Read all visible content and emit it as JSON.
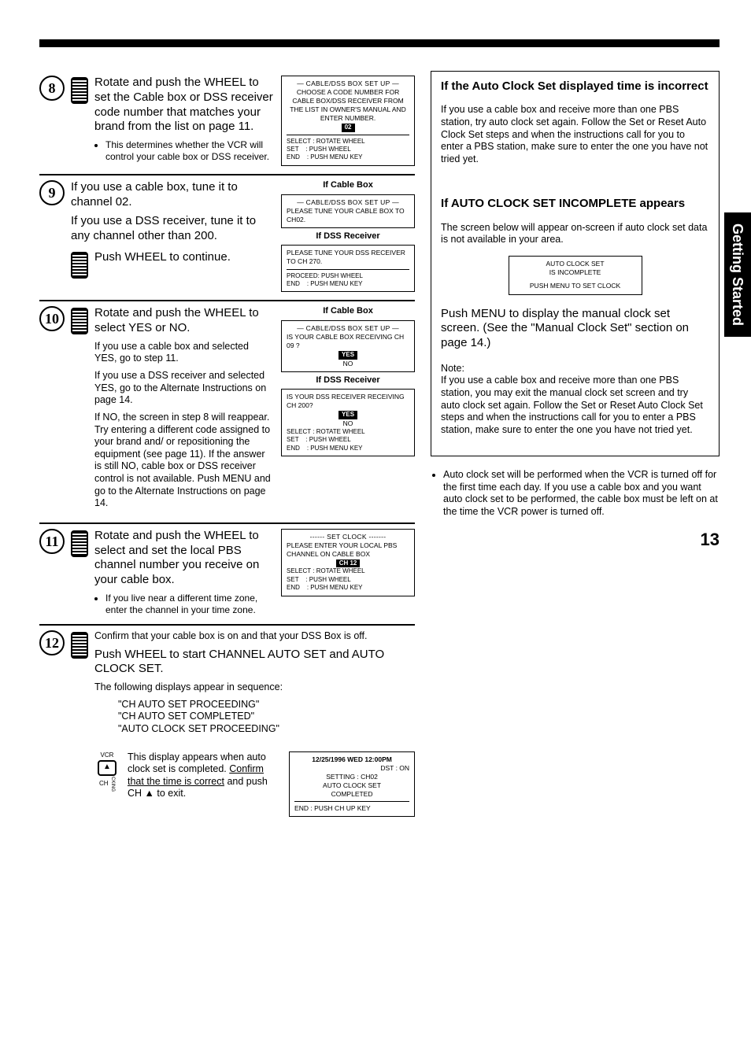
{
  "tab": "Getting Started",
  "page_number": "13",
  "steps": {
    "s8": {
      "num": "8",
      "main": "Rotate and push the WHEEL to set the Cable box or DSS receiver code number that matches your brand from the list on page 11.",
      "bullet": "This determines whether the VCR will control your cable box or DSS receiver.",
      "osd": {
        "title": "— CABLE/DSS BOX SET UP —",
        "body": "CHOOSE A CODE NUMBER FOR CABLE BOX/DSS RECEIVER FROM THE LIST IN OWNER'S MANUAL AND ENTER NUMBER.",
        "chip": "02",
        "legend": "SELECT : ROTATE WHEEL\nSET    : PUSH WHEEL\nEND    : PUSH MENU KEY"
      }
    },
    "s9": {
      "num": "9",
      "p1": "If you use a cable box, tune it to channel 02.",
      "p2": "If you use a DSS receiver, tune it to any channel other than 200.",
      "p3": "Push WHEEL to continue.",
      "osd_a_label": "If Cable Box",
      "osd_a": {
        "title": "— CABLE/DSS BOX SET UP —",
        "body": "PLEASE TUNE YOUR CABLE BOX TO CH02."
      },
      "osd_b_label": "If DSS Receiver",
      "osd_b": {
        "body": "PLEASE TUNE YOUR DSS RECEIVER TO CH 270.",
        "legend": "PROCEED: PUSH WHEEL\nEND    : PUSH MENU KEY"
      }
    },
    "s10": {
      "num": "10",
      "main": "Rotate and push the WHEEL to select YES or NO.",
      "p1": "If you use a cable box and selected YES, go to step 11.",
      "p2": "If you use a DSS receiver and selected YES, go to the Alternate Instructions on page 14.",
      "p3": "If NO, the screen in step 8 will reappear. Try entering a different code assigned to your brand and/ or repositioning the equipment (see page 11). If the answer is still NO, cable box or DSS receiver control is not available. Push MENU and go to the Alternate Instructions on page 14.",
      "osd_a_label": "If Cable Box",
      "osd_a": {
        "title": "— CABLE/DSS BOX SET UP —",
        "body": "IS YOUR CABLE BOX RECEIVING CH 09 ?",
        "chip": "YES",
        "opt": "NO"
      },
      "osd_b_label": "If DSS Receiver",
      "osd_b": {
        "body": "IS YOUR DSS RECEIVER RECEIVING CH 200?",
        "chip": "YES",
        "opt": "NO",
        "legend": "SELECT : ROTATE WHEEL\nSET    : PUSH WHEEL\nEND    : PUSH MENU KEY"
      }
    },
    "s11": {
      "num": "11",
      "main": "Rotate and push the WHEEL to select and set the local PBS channel number you receive on your cable box.",
      "bullet": "If you live near a different time zone, enter the channel in your time zone.",
      "osd": {
        "title": "------ SET CLOCK -------",
        "body": "PLEASE ENTER YOUR LOCAL PBS CHANNEL ON CABLE BOX",
        "chip": "CH 12",
        "legend": "SELECT : ROTATE WHEEL\nSET    : PUSH WHEEL\nEND    : PUSH MENU KEY"
      }
    },
    "s12": {
      "num": "12",
      "p1": "Confirm that your cable box is on and that your DSS Box is off.",
      "p2": "Push WHEEL to start CHANNEL AUTO SET and AUTO CLOCK SET.",
      "p3": "The following displays appear in sequence:",
      "seq1": "\"CH AUTO SET PROCEEDING\"",
      "seq2": "\"CH AUTO SET COMPLETED\"",
      "seq3": "\"AUTO CLOCK SET PROCEEDING\"",
      "conf_pre": "This display appears when auto clock set is completed. ",
      "conf_u": "Confirm that the time is correct",
      "conf_post": " and push CH ▲ to exit.",
      "vcr_top": "VCR",
      "vcr_bot": "CH",
      "vcr_side": "CKING",
      "osd": {
        "l1": "12/25/1996 WED 12:00PM",
        "l2": "DST : ON",
        "l3": "SETTING : CH02",
        "l4": "AUTO CLOCK SET",
        "l5": "COMPLETED",
        "l6": "END : PUSH CH UP KEY"
      }
    }
  },
  "side": {
    "box1": {
      "h": "If the Auto Clock Set displayed time is incorrect",
      "p": "If you use a cable box and receive more than one PBS station, try auto clock set again. Follow the Set or Reset Auto Clock Set steps and when the instructions call for you to enter a PBS station, make sure to enter the one you have not tried yet."
    },
    "box2": {
      "h": "If AUTO CLOCK SET INCOMPLETE appears",
      "p1": "The screen below will appear on-screen if auto clock set data is not available in your area.",
      "osd_l1": "AUTO CLOCK SET",
      "osd_l2": "IS INCOMPLETE",
      "osd_l3": "PUSH MENU TO SET CLOCK",
      "p2": "Push MENU to display the manual clock set screen. (See the \"Manual Clock Set\" section on page 14.)",
      "p3h": "Note:",
      "p3": "If you use a cable box and receive more than one PBS station, you may exit the manual clock set screen and try auto clock set again. Follow the Set or Reset Auto Clock Set steps and when the instructions call for you to enter a PBS station, make sure to enter the one you have not tried yet."
    },
    "bullet": "Auto clock set will be performed when the VCR is turned off for the first time each day. If you use a cable box and you want auto clock set to be performed, the cable box must be left on at the time the VCR power is turned off."
  }
}
